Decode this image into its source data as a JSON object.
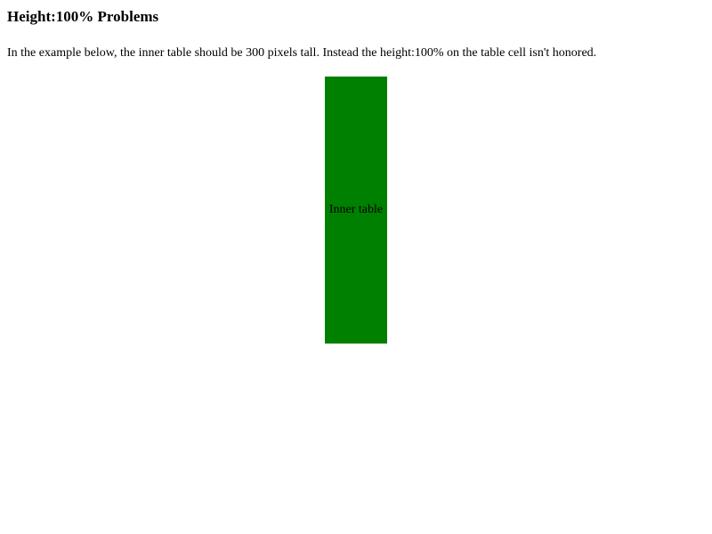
{
  "heading": "Height:100% Problems",
  "description": "In the example below, the inner table should be 300 pixels tall. Instead the height:100% on the table cell isn't honored.",
  "inner_table": {
    "label": "Inner table",
    "color": "#008000"
  }
}
